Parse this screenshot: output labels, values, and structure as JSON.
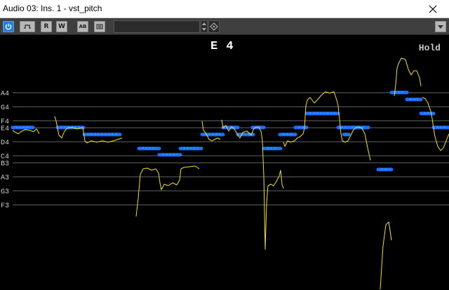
{
  "window": {
    "title": "Audio 03: Ins. 1 - vst_pitch"
  },
  "toolbar": {
    "read_label": "R",
    "write_label": "W",
    "ab_label": "AB",
    "preset_value": ""
  },
  "display": {
    "current_note": "E 4",
    "mode": "Hold",
    "note_labels": [
      {
        "name": "A4",
        "midi": 69
      },
      {
        "name": "G4",
        "midi": 67
      },
      {
        "name": "F4",
        "midi": 65
      },
      {
        "name": "E4",
        "midi": 64
      },
      {
        "name": "D4",
        "midi": 62
      },
      {
        "name": "C4",
        "midi": 60
      },
      {
        "name": "B3",
        "midi": 59
      },
      {
        "name": "A3",
        "midi": 57
      },
      {
        "name": "G3",
        "midi": 55
      },
      {
        "name": "F3",
        "midi": 53
      }
    ]
  },
  "colors": {
    "accent": "#2a7fd4",
    "note_segment": "#1e6fff",
    "note_segment_light": "#3aa0ff",
    "pitch_curve": "#f0e020",
    "grid": "#a0a0a0",
    "background": "#000000"
  }
}
